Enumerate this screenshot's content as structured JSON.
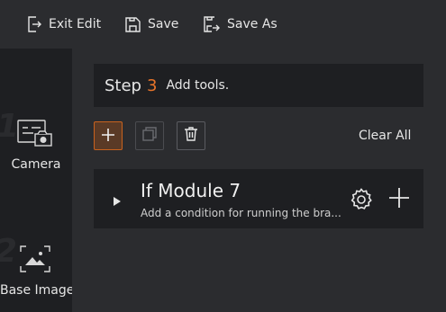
{
  "toolbar": {
    "exit_edit": "Exit Edit",
    "save": "Save",
    "save_as": "Save As"
  },
  "sidebar": {
    "items": [
      {
        "label": "Camera",
        "number": "1",
        "icon": "camera-icon"
      },
      {
        "label": "Base Image",
        "number": "2",
        "icon": "base-image-icon"
      }
    ]
  },
  "step": {
    "word": "Step",
    "number": "3",
    "description": "Add tools."
  },
  "actions": {
    "clear_all": "Clear All"
  },
  "module": {
    "title": "If Module 7",
    "description": "Add a condition for running the bra..."
  },
  "colors": {
    "accent": "#e8742a",
    "panel": "#1e1f22",
    "background": "#2b2c2f"
  }
}
